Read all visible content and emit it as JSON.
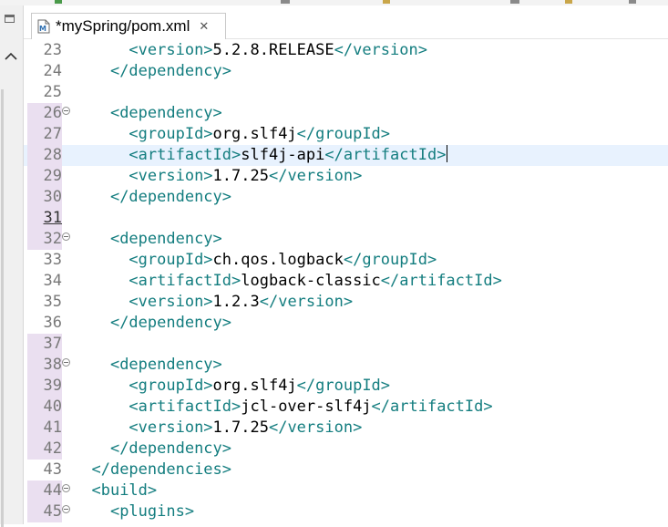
{
  "tab": {
    "title": "*mySpring/pom.xml",
    "close_icon": "close-icon",
    "file_icon": "xml-file-icon"
  },
  "sidebar": {
    "restore_icon": "restore-icon",
    "up_icon": "chevron-up-icon"
  },
  "colors": {
    "tag": "#137d7f",
    "text": "#000000",
    "line_number": "#787878",
    "current_line": "#e8f2fe",
    "quick_diff": "#62b3ad"
  },
  "editor": {
    "current_line": 28,
    "lines": [
      {
        "num": "23",
        "indent": "      ",
        "open": "<version>",
        "text": "5.2.8.RELEASE",
        "close": "</version>"
      },
      {
        "num": "24",
        "indent": "    ",
        "open": "</dependency>",
        "text": "",
        "close": ""
      },
      {
        "num": "25",
        "indent": "",
        "open": "",
        "text": "",
        "close": ""
      },
      {
        "num": "26",
        "indent": "    ",
        "open": "<dependency>",
        "text": "",
        "close": "",
        "fold": true
      },
      {
        "num": "27",
        "indent": "      ",
        "open": "<groupId>",
        "text": "org.slf4j",
        "close": "</groupId>"
      },
      {
        "num": "28",
        "indent": "      ",
        "open": "<artifactId>",
        "text": "slf4j-api",
        "close": "</artifactId>"
      },
      {
        "num": "29",
        "indent": "      ",
        "open": "<version>",
        "text": "1.7.25",
        "close": "</version>"
      },
      {
        "num": "30",
        "indent": "    ",
        "open": "</dependency>",
        "text": "",
        "close": ""
      },
      {
        "num": "31",
        "indent": "",
        "open": "",
        "text": "",
        "close": ""
      },
      {
        "num": "32",
        "indent": "    ",
        "open": "<dependency>",
        "text": "",
        "close": "",
        "fold": true
      },
      {
        "num": "33",
        "indent": "      ",
        "open": "<groupId>",
        "text": "ch.qos.logback",
        "close": "</groupId>"
      },
      {
        "num": "34",
        "indent": "      ",
        "open": "<artifactId>",
        "text": "logback-classic",
        "close": "</artifactId>"
      },
      {
        "num": "35",
        "indent": "      ",
        "open": "<version>",
        "text": "1.2.3",
        "close": "</version>"
      },
      {
        "num": "36",
        "indent": "    ",
        "open": "</dependency>",
        "text": "",
        "close": ""
      },
      {
        "num": "37",
        "indent": "",
        "open": "",
        "text": "",
        "close": ""
      },
      {
        "num": "38",
        "indent": "    ",
        "open": "<dependency>",
        "text": "",
        "close": "",
        "fold": true
      },
      {
        "num": "39",
        "indent": "      ",
        "open": "<groupId>",
        "text": "org.slf4j",
        "close": "</groupId>"
      },
      {
        "num": "40",
        "indent": "      ",
        "open": "<artifactId>",
        "text": "jcl-over-slf4j",
        "close": "</artifactId>"
      },
      {
        "num": "41",
        "indent": "      ",
        "open": "<version>",
        "text": "1.7.25",
        "close": "</version>"
      },
      {
        "num": "42",
        "indent": "    ",
        "open": "</dependency>",
        "text": "",
        "close": ""
      },
      {
        "num": "43",
        "indent": "  ",
        "open": "</dependencies>",
        "text": "",
        "close": ""
      },
      {
        "num": "44",
        "indent": "  ",
        "open": "<build>",
        "text": "",
        "close": "",
        "fold": true
      },
      {
        "num": "45",
        "indent": "    ",
        "open": "<plugins>",
        "text": "",
        "close": "",
        "fold": true
      }
    ]
  }
}
